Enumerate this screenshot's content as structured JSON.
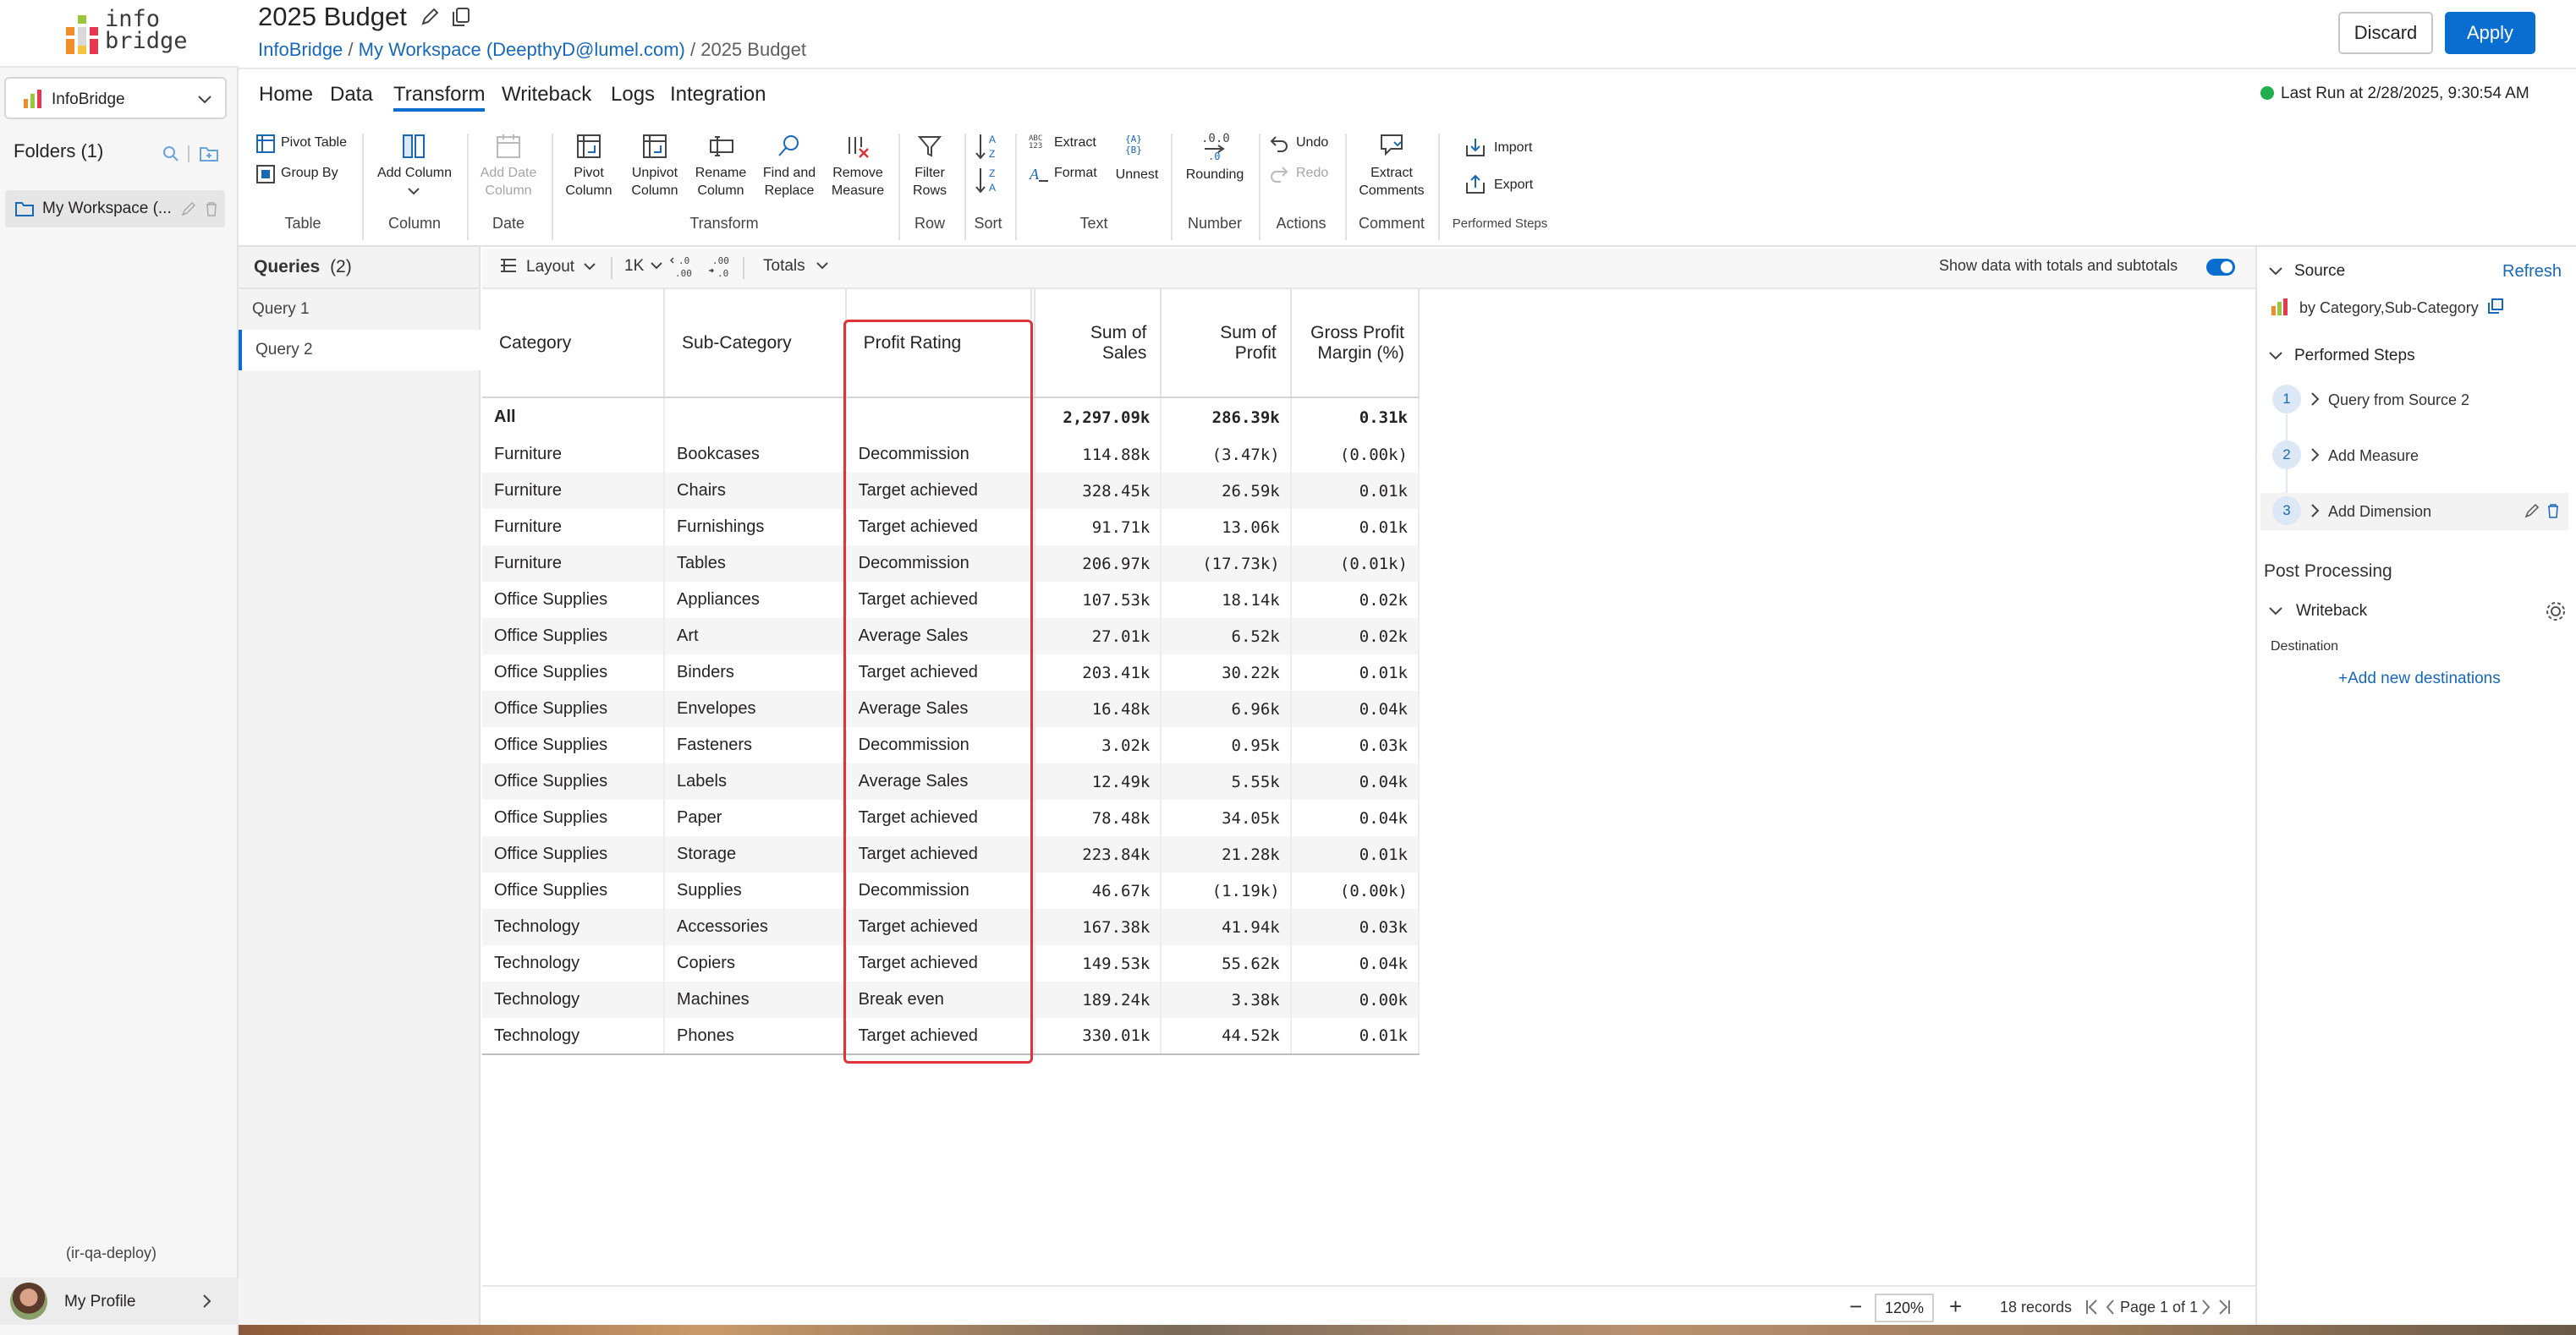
{
  "app": {
    "logo_line1": "info",
    "logo_line2": "bridge",
    "workspace_select": "InfoBridge",
    "folders_label": "Folders (1)",
    "folder_item": "My Workspace (...",
    "env_tag": "(ir-qa-deploy)",
    "profile_label": "My Profile"
  },
  "header": {
    "title": "2025 Budget",
    "breadcrumb": [
      {
        "label": "InfoBridge",
        "link": true
      },
      {
        "label": " / ",
        "link": false
      },
      {
        "label": "My Workspace (DeepthyD@lumel.com)",
        "link": true
      },
      {
        "label": " / 2025 Budget",
        "link": false
      }
    ],
    "discard_label": "Discard",
    "apply_label": "Apply"
  },
  "tabs": [
    "Home",
    "Data",
    "Transform",
    "Writeback",
    "Logs",
    "Integration"
  ],
  "active_tab": "Transform",
  "last_run": "Last Run at 2/28/2025, 9:30:54 AM",
  "ribbon": {
    "table": {
      "pivot_table": "Pivot Table",
      "group_by": "Group By",
      "group": "Table"
    },
    "column": {
      "add_column": "Add Column",
      "group": "Column"
    },
    "date": {
      "add_date_column_1": "Add Date",
      "add_date_column_2": "Column",
      "group": "Date"
    },
    "transform": {
      "pivot_1": "Pivot",
      "pivot_2": "Column",
      "unpivot_1": "Unpivot",
      "unpivot_2": "Column",
      "rename_1": "Rename",
      "rename_2": "Column",
      "find_1": "Find and",
      "find_2": "Replace",
      "remove_1": "Remove",
      "remove_2": "Measure",
      "group": "Transform"
    },
    "row": {
      "filter_1": "Filter",
      "filter_2": "Rows",
      "group": "Row"
    },
    "sort": {
      "group": "Sort"
    },
    "text": {
      "extract": "Extract",
      "format": "Format",
      "unnest": "Unnest",
      "group": "Text"
    },
    "number": {
      "rounding": "Rounding",
      "group": "Number"
    },
    "actions": {
      "undo": "Undo",
      "redo": "Redo",
      "group": "Actions"
    },
    "comment": {
      "extract_1": "Extract",
      "extract_2": "Comments",
      "group": "Comment"
    },
    "performed": {
      "import": "Import",
      "export": "Export",
      "group": "Performed Steps"
    }
  },
  "queries": {
    "title": "Queries",
    "count": "(2)",
    "items": [
      "Query 1",
      "Query 2"
    ]
  },
  "toolbar": {
    "layout": "Layout",
    "scale": "1K",
    "totals": "Totals",
    "show_totals_label": "Show data with totals and subtotals"
  },
  "table": {
    "columns": [
      "Category",
      "Sub-Category",
      "Profit Rating",
      "Sum of Sales",
      "Sum of Profit",
      "Gross Profit Margin (%)"
    ],
    "total_row": [
      "All",
      "",
      "",
      "2,297.09k",
      "286.39k",
      "0.31k"
    ],
    "rows": [
      [
        "Furniture",
        "Bookcases",
        "Decommission",
        "114.88k",
        "(3.47k)",
        "(0.00k)"
      ],
      [
        "Furniture",
        "Chairs",
        "Target achieved",
        "328.45k",
        "26.59k",
        "0.01k"
      ],
      [
        "Furniture",
        "Furnishings",
        "Target achieved",
        "91.71k",
        "13.06k",
        "0.01k"
      ],
      [
        "Furniture",
        "Tables",
        "Decommission",
        "206.97k",
        "(17.73k)",
        "(0.01k)"
      ],
      [
        "Office Supplies",
        "Appliances",
        "Target achieved",
        "107.53k",
        "18.14k",
        "0.02k"
      ],
      [
        "Office Supplies",
        "Art",
        "Average Sales",
        "27.01k",
        "6.52k",
        "0.02k"
      ],
      [
        "Office Supplies",
        "Binders",
        "Target achieved",
        "203.41k",
        "30.22k",
        "0.01k"
      ],
      [
        "Office Supplies",
        "Envelopes",
        "Average Sales",
        "16.48k",
        "6.96k",
        "0.04k"
      ],
      [
        "Office Supplies",
        "Fasteners",
        "Decommission",
        "3.02k",
        "0.95k",
        "0.03k"
      ],
      [
        "Office Supplies",
        "Labels",
        "Average Sales",
        "12.49k",
        "5.55k",
        "0.04k"
      ],
      [
        "Office Supplies",
        "Paper",
        "Target achieved",
        "78.48k",
        "34.05k",
        "0.04k"
      ],
      [
        "Office Supplies",
        "Storage",
        "Target achieved",
        "223.84k",
        "21.28k",
        "0.01k"
      ],
      [
        "Office Supplies",
        "Supplies",
        "Decommission",
        "46.67k",
        "(1.19k)",
        "(0.00k)"
      ],
      [
        "Technology",
        "Accessories",
        "Target achieved",
        "167.38k",
        "41.94k",
        "0.03k"
      ],
      [
        "Technology",
        "Copiers",
        "Target achieved",
        "149.53k",
        "55.62k",
        "0.04k"
      ],
      [
        "Technology",
        "Machines",
        "Break even",
        "189.24k",
        "3.38k",
        "0.00k"
      ],
      [
        "Technology",
        "Phones",
        "Target achieved",
        "330.01k",
        "44.52k",
        "0.01k"
      ]
    ]
  },
  "right_panel": {
    "source_title": "Source",
    "refresh": "Refresh",
    "source_desc": "by Category,Sub-Category",
    "performed_steps_title": "Performed Steps",
    "steps": [
      {
        "num": "1",
        "label": "Query from Source 2"
      },
      {
        "num": "2",
        "label": "Add Measure"
      },
      {
        "num": "3",
        "label": "Add Dimension"
      }
    ],
    "post_processing": "Post Processing",
    "writeback": "Writeback",
    "destination": "Destination",
    "add_destination": "+Add new destinations"
  },
  "footer": {
    "zoom": "120%",
    "records": "18 records",
    "page": "Page 1 of 1"
  },
  "colors": {
    "accent": "#0a6ed1",
    "link": "#1769b8",
    "highlight": "#e0323a",
    "status_ok": "#1fae4b"
  }
}
